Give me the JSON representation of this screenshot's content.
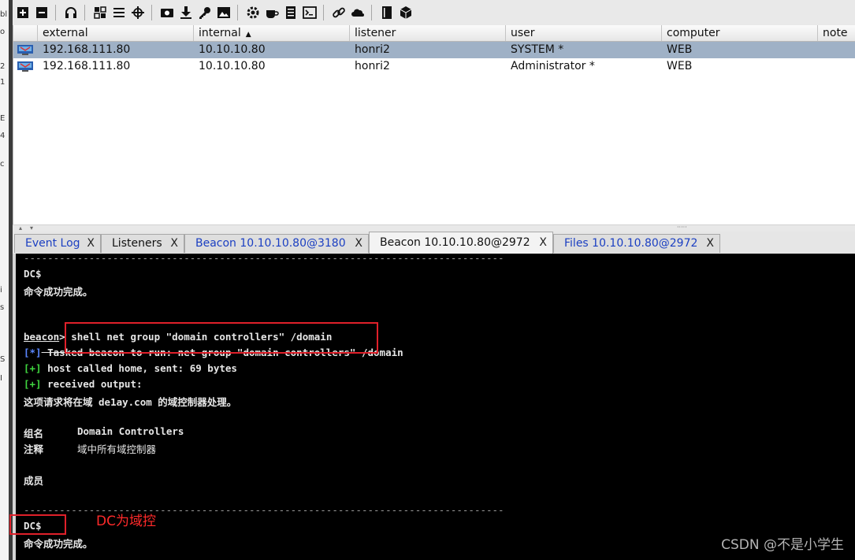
{
  "left_strip_chars": [
    "bl",
    "o",
    "2",
    "1",
    "E",
    "4",
    "c",
    "i",
    "s",
    "S",
    "I"
  ],
  "toolbar": {
    "icons": [
      "connect-icon",
      "disconnect-icon",
      "headphones-icon",
      "pivot-graph-icon",
      "session-list-icon",
      "targets-icon",
      "screenshot-icon",
      "download-icon",
      "credentials-icon",
      "image-icon",
      "settings-icon",
      "coffee-icon",
      "script-icon",
      "console-icon",
      "link-icon",
      "cloud-icon",
      "book-icon",
      "box-icon"
    ]
  },
  "table": {
    "columns": [
      "external",
      "internal",
      "listener",
      "user",
      "computer",
      "note"
    ],
    "sorted_column": "internal",
    "rows": [
      {
        "external": "192.168.111.80",
        "internal": "10.10.10.80",
        "listener": "honri2",
        "user": "SYSTEM *",
        "computer": "WEB",
        "note": "",
        "selected": true
      },
      {
        "external": "192.168.111.80",
        "internal": "10.10.10.80",
        "listener": "honri2",
        "user": "Administrator *",
        "computer": "WEB",
        "note": "",
        "selected": false
      }
    ]
  },
  "tabs": [
    {
      "label": "Event Log",
      "close": "X",
      "active": false
    },
    {
      "label": "Listeners",
      "close": "X",
      "active": false
    },
    {
      "label": "Beacon 10.10.10.80@3180",
      "close": "X",
      "active": false
    },
    {
      "label": "Beacon 10.10.10.80@2972",
      "close": "X",
      "active": true
    },
    {
      "label": "Files 10.10.10.80@2972",
      "close": "X",
      "active": false
    }
  ],
  "console": {
    "dash_line": "---------------------------------------------------------------------------------",
    "line_dc1": "DC$",
    "line_ok1": "命令成功完成。",
    "prompt": "beacon",
    "prompt_sep": ">",
    "command": " shell net group \"domain controllers\" /domain",
    "tag_star": "[*]",
    "tasked": " Tasked beacon to run: net group \"domain controllers\"",
    "tasked_tail": " /domain",
    "tag_plus": "[+]",
    "host_called": " host called home, sent: 69 bytes",
    "received": " received output:",
    "request_line": "这项请求将在域 de1ay.com 的域控制器处理。",
    "group_name_label": "组名",
    "group_name_value": "Domain Controllers",
    "comment_label": "注释",
    "comment_value": "域中所有域控制器",
    "members_label": "成员",
    "line_dc2": "DC$",
    "line_ok2": "命令成功完成。"
  },
  "annotation": "DC为域控",
  "watermark": "CSDN @不是小学生",
  "colors": {
    "selected_row": "#9fb1c6",
    "annotation_red": "#e0202a",
    "tab_blue": "#1b3fc2",
    "console_bg": "#000000"
  }
}
